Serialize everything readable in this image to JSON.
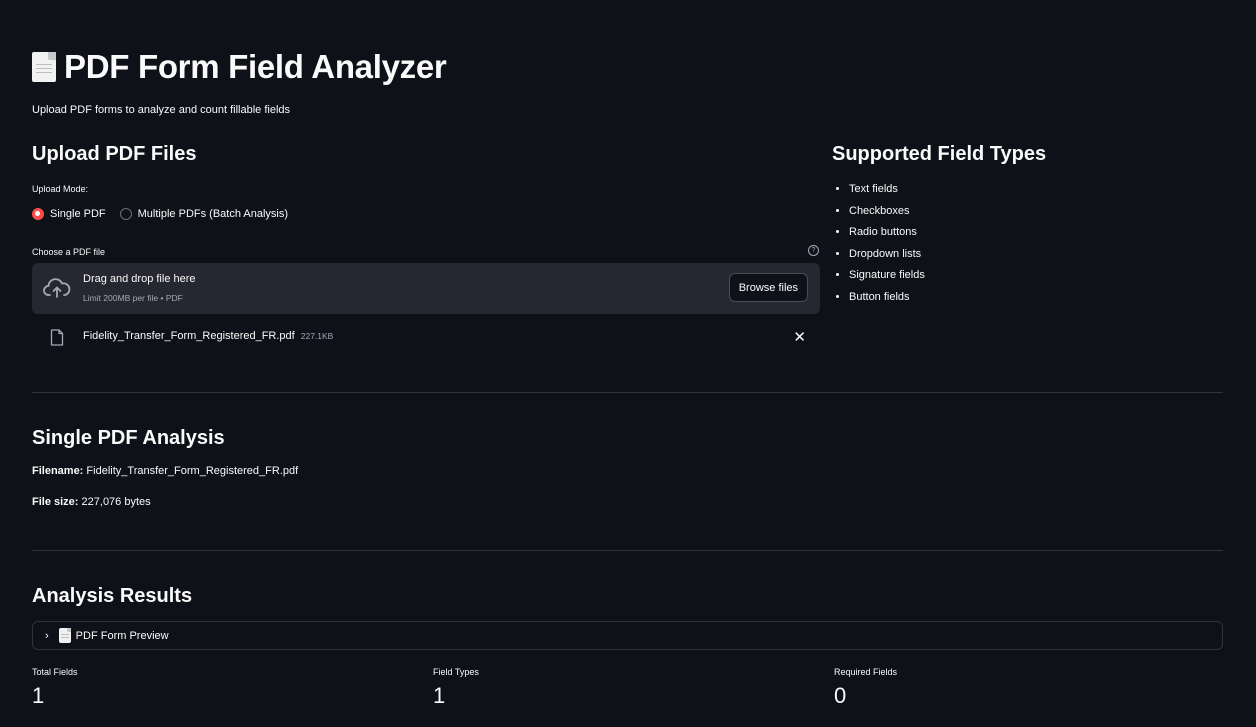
{
  "app": {
    "title": "PDF Form Field Analyzer",
    "subtitle": "Upload PDF forms to analyze and count fillable fields"
  },
  "upload": {
    "heading": "Upload PDF Files",
    "mode_label": "Upload Mode:",
    "modes": [
      {
        "label": "Single PDF",
        "selected": true
      },
      {
        "label": "Multiple PDFs (Batch Analysis)",
        "selected": false
      }
    ],
    "uploader_label": "Choose a PDF file",
    "dropzone_text": "Drag and drop file here",
    "dropzone_limit": "Limit 200MB per file • PDF",
    "browse_label": "Browse files",
    "file": {
      "name": "Fidelity_Transfer_Form_Registered_FR.pdf",
      "size": "227.1KB"
    }
  },
  "supported": {
    "heading": "Supported Field Types",
    "items": [
      "Text fields",
      "Checkboxes",
      "Radio buttons",
      "Dropdown lists",
      "Signature fields",
      "Button fields"
    ]
  },
  "analysis": {
    "heading": "Single PDF Analysis",
    "filename_label": "Filename:",
    "filename_value": "Fidelity_Transfer_Form_Registered_FR.pdf",
    "filesize_label": "File size:",
    "filesize_value": "227,076 bytes"
  },
  "results": {
    "heading": "Analysis Results",
    "preview_label": "PDF Form Preview",
    "metrics": [
      {
        "label": "Total Fields",
        "value": "1"
      },
      {
        "label": "Field Types",
        "value": "1"
      },
      {
        "label": "Required Fields",
        "value": "0"
      }
    ]
  },
  "colors": {
    "background": "#0e1117",
    "accent": "#ff4b4b",
    "surface": "#262730"
  }
}
